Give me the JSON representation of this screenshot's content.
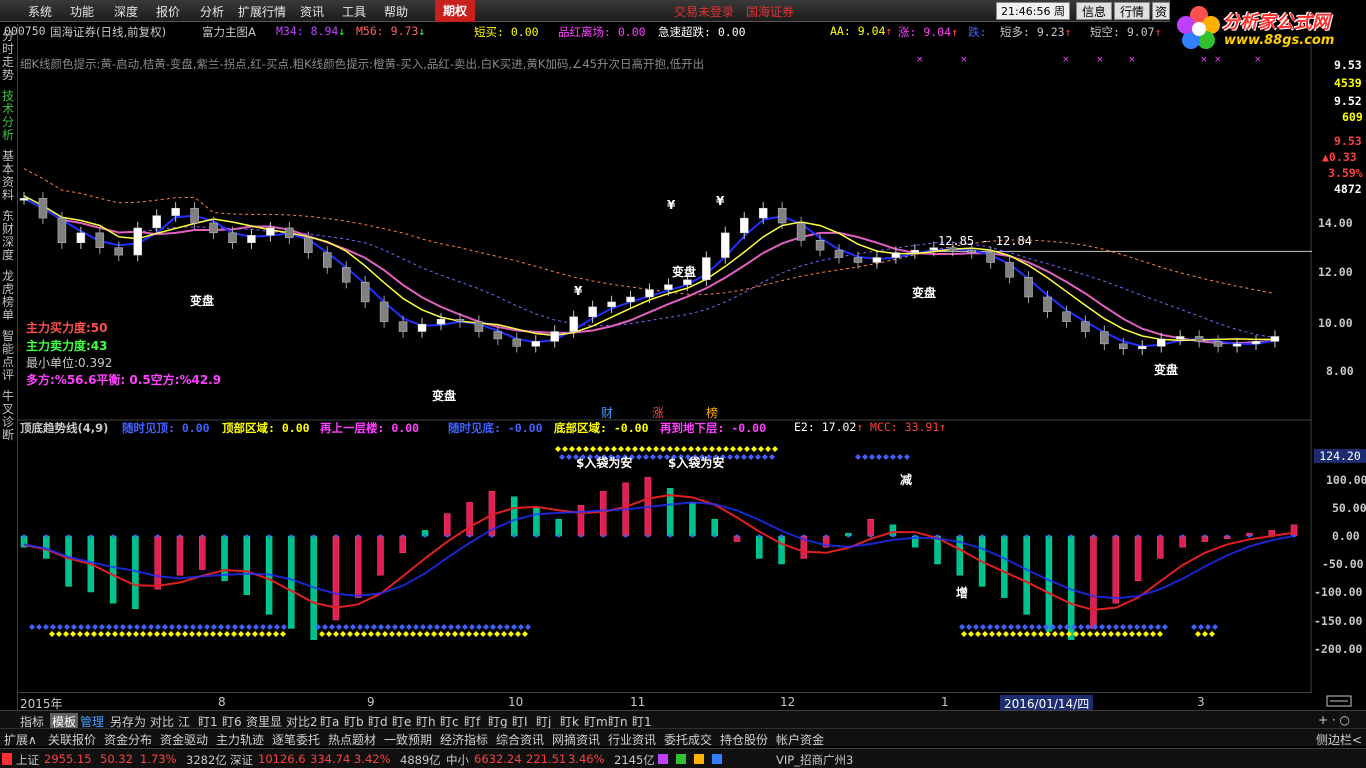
{
  "menu": {
    "items": [
      "系统",
      "功能",
      "深度",
      "报价",
      "分析",
      "扩展行情",
      "资讯",
      "工具",
      "帮助"
    ],
    "options_tab": "期权",
    "trade_status": "交易未登录",
    "broker": "国海证券",
    "clock": "21:46:56 周日",
    "right_buttons": [
      "信息",
      "行情",
      "资"
    ]
  },
  "logo": {
    "text": "分析家公式网",
    "url": "www.88gs.com"
  },
  "header": {
    "code": "000750",
    "name": "国海证券(日线,前复权)",
    "indicator": "富力主图A",
    "m34_label": "M34:",
    "m34_value": "8.94",
    "m56_label": "M56:",
    "m56_value": "9.73",
    "short_buy_label": "短买:",
    "short_buy_value": "0.00",
    "red_exit_label": "品红离场:",
    "red_exit_value": "0.00",
    "rapid_label": "急速超跌:",
    "rapid_value": "0.00",
    "aa_label": "AA:",
    "aa_value": "9.04",
    "up_label": "涨:",
    "up_value": "9.04",
    "down_label": "跌:",
    "short_long_label": "短多:",
    "short_long_value": "9.23",
    "short_short_label": "短空:",
    "short_short_value": "9.07"
  },
  "notice": "细K线颜色提示:黄-启动,桔黄-变盘,紫兰-拐点,红-买点.粗K线颜色提示:橙黄-买入,品红-卖出.白K买进,黄K加码,∠45升次日高开抱,低开出",
  "vtabs": [
    "分时走势",
    "技术分析",
    "基本资料",
    "东财深度",
    "龙虎榜单",
    "智能点评",
    "牛叉诊断"
  ],
  "main_labels": {
    "buy_force": "主力买力度:50",
    "sell_force": "主力卖力度:43",
    "min_unit": "最小单位:0.392",
    "balance": "多方:%56.6平衡: 0.5空方:%42.9",
    "turn1": "变盘",
    "turn2": "变盘",
    "turn3": "变盘",
    "turn4": "变盘",
    "turn5": "变盘",
    "range_label": "12.85 - 12.84",
    "yen": "¥"
  },
  "right_axis_main": [
    "9.53",
    "4539",
    "9.52",
    "609",
    "9.53",
    "▲0.33",
    "3.59%",
    "4872",
    "14.00",
    "12.00",
    "10.00",
    "8.00"
  ],
  "markers": {
    "cai": "财",
    "zhang": "涨",
    "bang": "榜"
  },
  "sub_header": {
    "title": "顶底趋势线(4,9)",
    "see_top_label": "随时见顶:",
    "see_top_value": "0.00",
    "top_zone_label": "顶部区域:",
    "top_zone_value": "0.00",
    "up_floor_label": "再上一层楼:",
    "up_floor_value": "0.00",
    "see_bottom_label": "随时见底:",
    "see_bottom_value": "-0.00",
    "bottom_zone_label": "底部区域:",
    "bottom_zone_value": "-0.00",
    "down_floor_label": "再到地下层:",
    "down_floor_value": "-0.00",
    "e2_label": "E2:",
    "e2_value": "17.02",
    "mcc_label": "MCC:",
    "mcc_value": "33.91"
  },
  "sub_labels": {
    "safe1": "$入袋为安",
    "safe2": "$入袋为安",
    "reduce": "减",
    "add": "增"
  },
  "sub_axis": {
    "highlight": "124.20",
    "ticks": [
      "100.00",
      "50.00",
      "0.00",
      "-50.00",
      "-100.00",
      "-150.00",
      "-200.00"
    ]
  },
  "x_axis": [
    "2015年",
    "8",
    "9",
    "10",
    "11",
    "12",
    "1",
    "2016/01/14/四",
    "3"
  ],
  "toolbar1": {
    "items": [
      "指标",
      "模板",
      "管理",
      "另存为",
      "对比",
      "江",
      "盯1",
      "盯6",
      "资里显",
      "对比2",
      "盯a",
      "盯b",
      "盯d",
      "盯e",
      "盯h",
      "盯c",
      "盯f",
      "盯g",
      "盯I",
      "盯j",
      "盯k",
      "盯m",
      "盯n",
      "盯1"
    ],
    "right": "+ · ○"
  },
  "toolbar2": {
    "items": [
      "扩展∧",
      "关联报价",
      "资金分布",
      "资金驱动",
      "主力轨迹",
      "逐笔委托",
      "热点题材",
      "一致预期",
      "经济指标",
      "综合资讯",
      "网摘资讯",
      "行业资讯",
      "委托成交",
      "持仓股份",
      "帐户资金"
    ],
    "right": "侧边栏<"
  },
  "status": {
    "sh_label": "上证",
    "sh_value": "2955.15",
    "sh_change": "50.32",
    "sh_pct": "1.73%",
    "sh_amount": "3282亿",
    "sz_label": "深证",
    "sz_value": "10126.6",
    "sz_change": "334.74",
    "sz_pct": "3.42%",
    "sz_amount": "4889亿",
    "zx_label": "中小",
    "zx_value": "6632.24",
    "zx_change": "221.51",
    "zx_pct": "3.46%",
    "zx_amount": "2145亿",
    "vip": "VIP_招商广州3"
  },
  "colors": {
    "up": "#ff3030",
    "down": "#00c8b0",
    "yellow": "#ffff00",
    "blue": "#2030ff",
    "magenta": "#ff40ff"
  },
  "chart_data": {
    "type": "candlestick",
    "series": [
      {
        "name": "K线",
        "values": [
          15.0,
          14.2,
          13.2,
          13.6,
          13.0,
          12.7,
          13.8,
          14.3,
          14.6,
          14.0,
          13.6,
          13.2,
          13.5,
          13.8,
          13.4,
          12.8,
          12.2,
          11.6,
          10.8,
          10.0,
          9.6,
          9.9,
          10.1,
          10.0,
          9.6,
          9.3,
          9.0,
          9.2,
          9.6,
          10.2,
          10.6,
          10.8,
          11.0,
          11.3,
          11.5,
          11.7,
          12.6,
          13.6,
          14.2,
          14.6,
          14.0,
          13.3,
          12.9,
          12.6,
          12.4,
          12.6,
          12.8,
          12.9,
          13.0,
          12.9,
          12.8,
          12.4,
          11.8,
          11.0,
          10.4,
          10.0,
          9.6,
          9.1,
          8.9,
          9.0,
          9.3,
          9.4,
          9.2,
          9.0,
          9.1,
          9.2,
          9.4
        ]
      },
      {
        "name": "MACD",
        "values": [
          -20,
          -40,
          -90,
          -100,
          -120,
          -130,
          -95,
          -70,
          -60,
          -80,
          -105,
          -140,
          -165,
          -185,
          -150,
          -110,
          -70,
          -30,
          10,
          40,
          60,
          80,
          70,
          50,
          30,
          55,
          80,
          95,
          105,
          85,
          60,
          30,
          -10,
          -40,
          -50,
          -40,
          -20,
          5,
          30,
          20,
          -20,
          -50,
          -70,
          -90,
          -110,
          -140,
          -170,
          -185,
          -165,
          -120,
          -80,
          -40,
          -20,
          -10,
          -5,
          5,
          10,
          20
        ]
      }
    ],
    "ylim": [
      8.0,
      14.0
    ],
    "sub_ylim": [
      -200,
      150
    ]
  }
}
